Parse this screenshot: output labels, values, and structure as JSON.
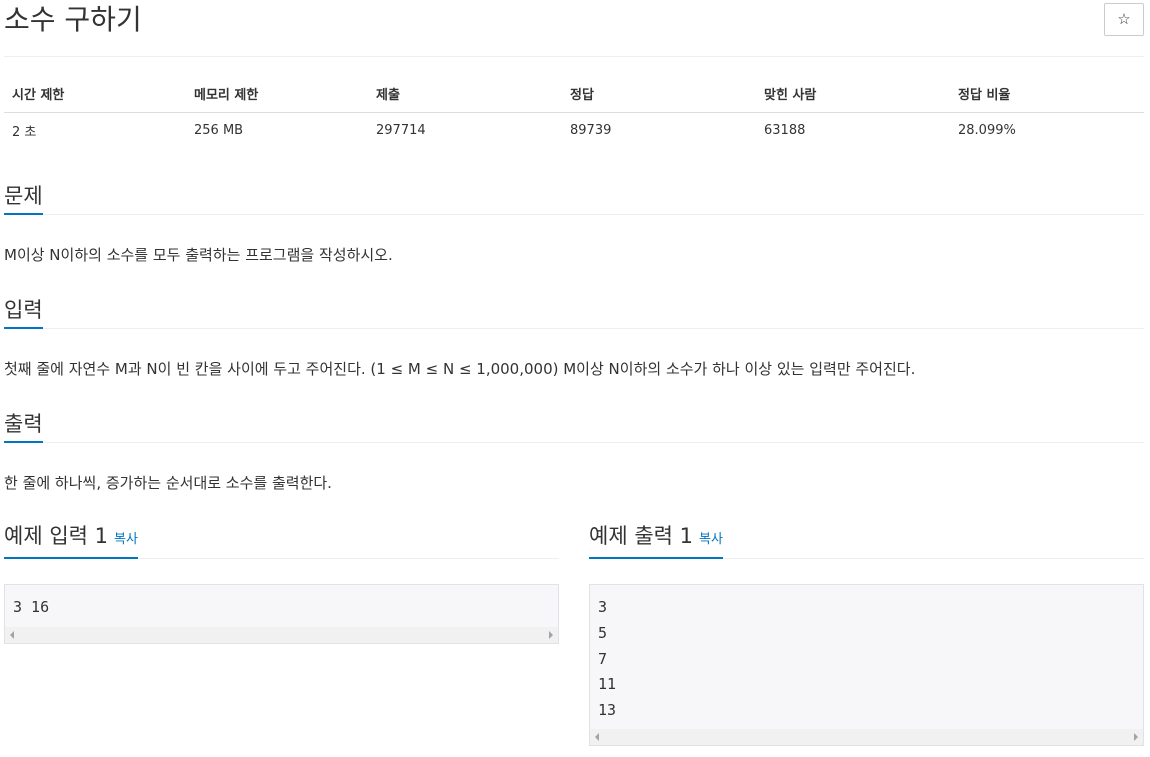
{
  "page": {
    "title": "소수 구하기",
    "star": "☆"
  },
  "info": {
    "headers": [
      "시간 제한",
      "메모리 제한",
      "제출",
      "정답",
      "맞힌 사람",
      "정답 비율"
    ],
    "values": [
      "2 초",
      "256 MB",
      "297714",
      "89739",
      "63188",
      "28.099%"
    ]
  },
  "problem": {
    "heading": "문제",
    "text": "M이상 N이하의 소수를 모두 출력하는 프로그램을 작성하시오."
  },
  "input": {
    "heading": "입력",
    "text": "첫째 줄에 자연수 M과 N이 빈 칸을 사이에 두고 주어진다. (1 ≤ M ≤ N ≤ 1,000,000) M이상 N이하의 소수가 하나 이상 있는 입력만 주어진다."
  },
  "output": {
    "heading": "출력",
    "text": "한 줄에 하나씩, 증가하는 순서대로 소수를 출력한다."
  },
  "sample_input": {
    "heading": "예제 입력 1",
    "copy": "복사",
    "lines": [
      "3 16"
    ]
  },
  "sample_output": {
    "heading": "예제 출력 1",
    "copy": "복사",
    "lines": [
      "3",
      "5",
      "7",
      "11",
      "13"
    ]
  },
  "colors": {
    "accent": "#0076c0",
    "pre_bg": "#f7f7f9"
  }
}
